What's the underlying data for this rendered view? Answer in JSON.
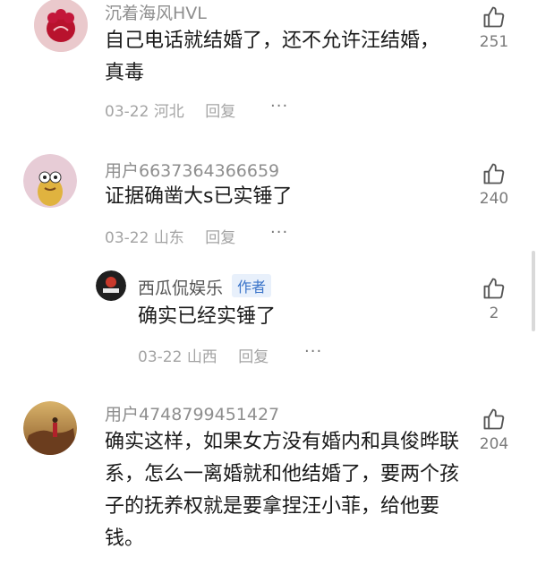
{
  "comments": [
    {
      "username": "沉着海风HVL",
      "text": "自己电话就结婚了，还不允许汪结婚，真毒",
      "date": "03-22",
      "location": "河北",
      "reply_label": "回复",
      "more_label": "···",
      "likes": "251",
      "avatar_icon": "red-flower-avatar-icon"
    },
    {
      "username": "用户6637364366659",
      "text": "证据确凿大s已实锤了",
      "date": "03-22",
      "location": "山东",
      "reply_label": "回复",
      "more_label": "···",
      "likes": "240",
      "avatar_icon": "cartoon-character-avatar-icon"
    },
    {
      "username": "西瓜侃娱乐",
      "author_tag": "作者",
      "text": "确实已经实锤了",
      "date": "03-22",
      "location": "山西",
      "reply_label": "回复",
      "more_label": "···",
      "likes": "2",
      "avatar_icon": "channel-logo-avatar-icon"
    },
    {
      "username": "用户4748799451427",
      "text": "确实这样，如果女方没有婚内和具俊晔联系，怎么一离婚就和他结婚了，要两个孩子的抚养权就是要拿捏汪小菲，给他要钱。",
      "likes": "204",
      "avatar_icon": "autumn-scene-avatar-icon"
    }
  ],
  "colors": {
    "text": "#1a1a1a",
    "username": "#8e8e8e",
    "meta": "#a4a4a4",
    "author_tag": "#3b74c9",
    "background": "#ffffff"
  }
}
